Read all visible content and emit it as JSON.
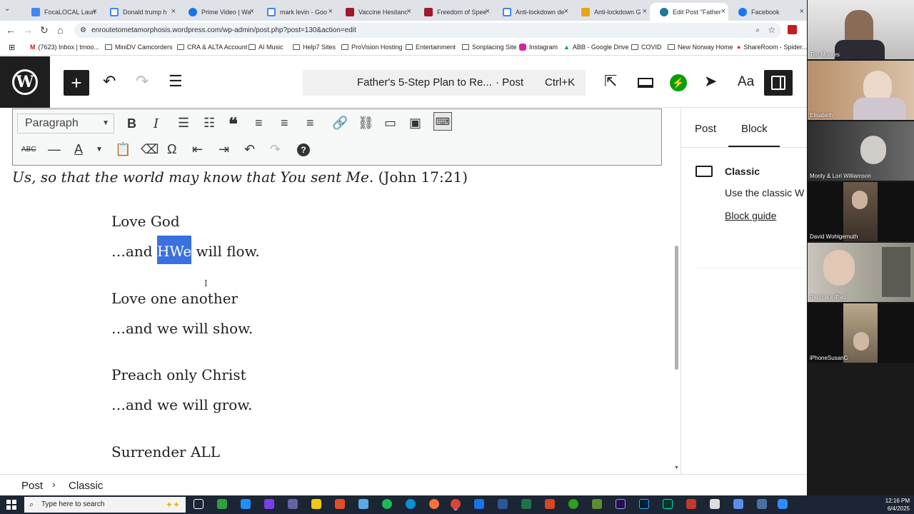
{
  "browser": {
    "tabs": [
      {
        "title": "FocaLOCAL Laun",
        "color": "#4285f4"
      },
      {
        "title": "Donald trump h",
        "color": "#4285f4"
      },
      {
        "title": "Prime Video | Wa",
        "color": "#1a73e8"
      },
      {
        "title": "mark levin - Goo",
        "color": "#4285f4"
      },
      {
        "title": "Vaccine Hesitanc",
        "color": "#a0182c"
      },
      {
        "title": "Freedom of Spee",
        "color": "#a0182c"
      },
      {
        "title": "Anti-lockdown de",
        "color": "#4285f4"
      },
      {
        "title": "Anti-lockdown G",
        "color": "#e8a317"
      },
      {
        "title": "Edit Post \"Father",
        "color": "#21759b"
      },
      {
        "title": "Facebook",
        "color": "#1877f2"
      }
    ],
    "url": "enroutetometamorphosis.wordpress.com/wp-admin/post.php?post=130&action=edit",
    "bookmarks": [
      "(7623) Inbox | tmoo...",
      "MiniDV Camcorders",
      "CRA & ALTA Account",
      "AI Music",
      "Help7 Sites",
      "ProVision Hosting",
      "Entertainment",
      "Sonplacing Site",
      "Instagram",
      "ABB - Google Drive",
      "COVID",
      "New Norway Home",
      "ShareRoom - Spider..."
    ]
  },
  "wp": {
    "command_title": "Father's 5-Step Plan to Re...",
    "command_type": "· Post",
    "command_shortcut": "Ctrl+K",
    "aa_label": "Aa"
  },
  "toolbar": {
    "format": "Paragraph"
  },
  "editor": {
    "verse_italic": "Us, so that the world may know that You sent Me.",
    "verse_ref": " (John 17:21)",
    "lines": {
      "l1": "Love God",
      "l2_pre": "…and ",
      "l2_hl": "HWe",
      "l2_post": " will flow.",
      "l3": "Love one another",
      "l4": "…and we will show.",
      "l5": "Preach only Christ",
      "l6": "…and we will grow.",
      "l7": "Surrender ALL"
    }
  },
  "panel": {
    "tab_post": "Post",
    "tab_block": "Block",
    "block_name": "Classic",
    "block_desc": "Use the classic W",
    "block_guide": "Block guide"
  },
  "footer": {
    "crumb1": "Post",
    "crumb2": "Classic"
  },
  "zoom": [
    {
      "name": "Tim Moores"
    },
    {
      "name": "Elisabeth"
    },
    {
      "name": "Monty & Lori Williamson"
    },
    {
      "name": "David Wohlgemuth"
    },
    {
      "name": "Patricia's iPad"
    },
    {
      "name": "iPhoneSusanC"
    }
  ],
  "taskbar": {
    "search_placeholder": "Type here to search",
    "time": "12:16 PM",
    "date": "6/4/2025"
  }
}
